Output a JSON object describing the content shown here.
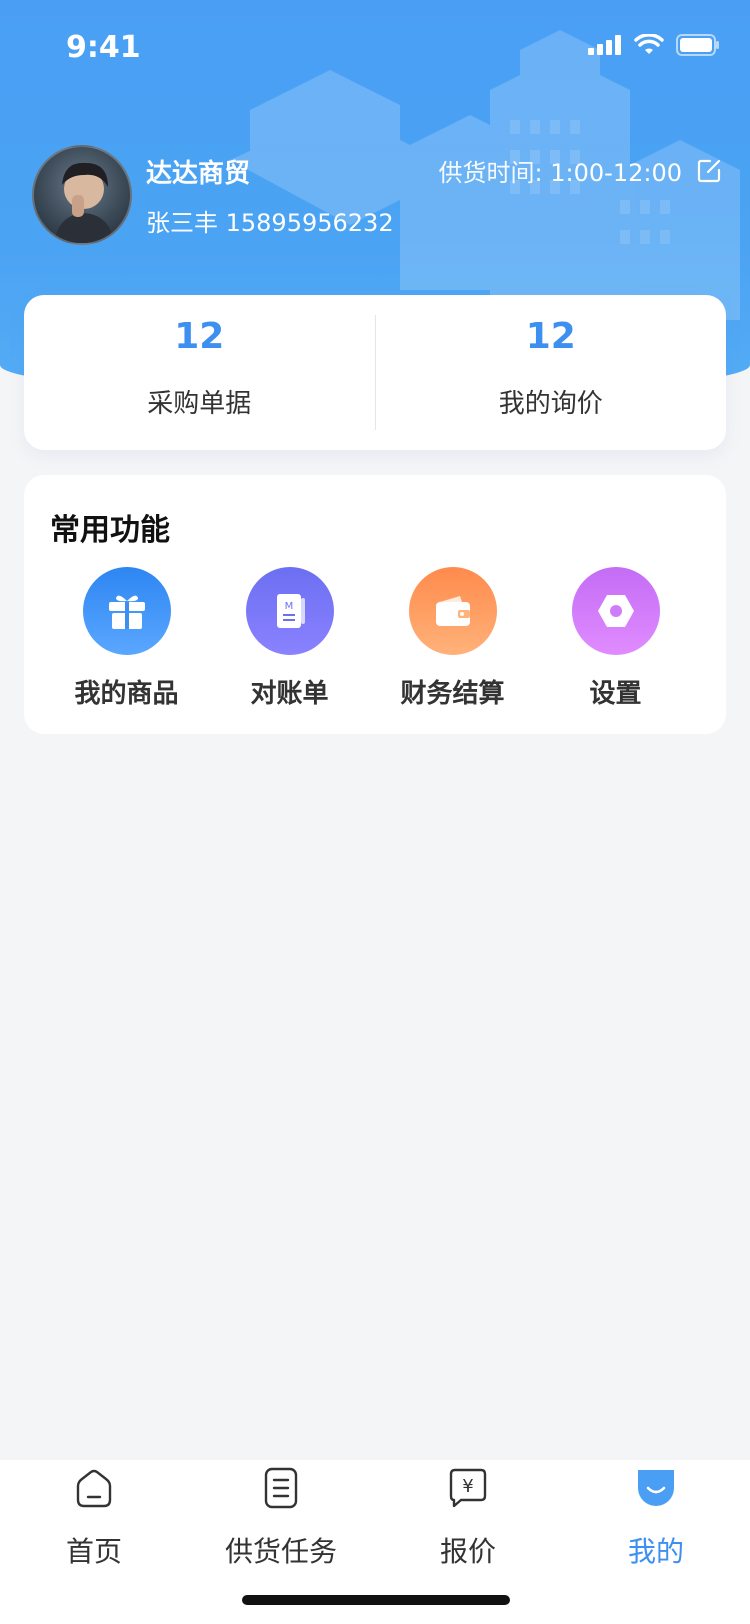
{
  "status_bar": {
    "time": "9:41"
  },
  "profile": {
    "company": "达达商贸",
    "contact": "张三丰 15895956232",
    "supply_label": "供货时间:",
    "supply_time": "1:00-12:00"
  },
  "stats": [
    {
      "value": "12",
      "label": "采购单据"
    },
    {
      "value": "12",
      "label": "我的询价"
    }
  ],
  "functions": {
    "title": "常用功能",
    "items": [
      {
        "label": "我的商品",
        "icon": "gift-icon"
      },
      {
        "label": "对账单",
        "icon": "bill-icon"
      },
      {
        "label": "财务结算",
        "icon": "wallet-icon"
      },
      {
        "label": "设置",
        "icon": "settings-icon"
      }
    ]
  },
  "tabs": [
    {
      "label": "首页",
      "icon": "home-icon"
    },
    {
      "label": "供货任务",
      "icon": "document-icon"
    },
    {
      "label": "报价",
      "icon": "quote-icon"
    },
    {
      "label": "我的",
      "icon": "profile-icon",
      "active": true
    }
  ],
  "colors": {
    "accent": "#3d8ff0",
    "header_top": "#4a9ff4",
    "gift_gradient": [
      "#2e86f2",
      "#5aa7ff"
    ],
    "bill_gradient": [
      "#6c6ff2",
      "#8a82ff"
    ],
    "wallet_gradient": [
      "#ff8a4c",
      "#ffb27a"
    ],
    "settings_gradient": [
      "#c46cf5",
      "#e08cff"
    ]
  }
}
